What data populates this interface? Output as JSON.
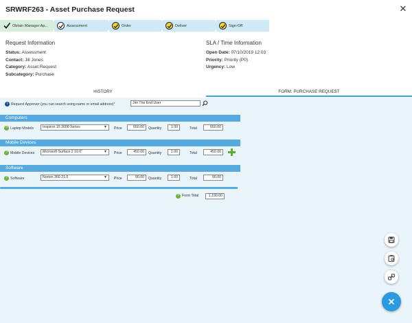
{
  "window": {
    "title": "SRWRF263 - Asset Purchase Request"
  },
  "stages": [
    {
      "label": "Obtain Manager Ap...",
      "state": "done"
    },
    {
      "label": "Assessment",
      "state": "current"
    },
    {
      "label": "Order",
      "state": "pending"
    },
    {
      "label": "Deliver",
      "state": "pending"
    },
    {
      "label": "Sign-Off",
      "state": "pending"
    }
  ],
  "request_info": {
    "heading": "Request Information",
    "rows": [
      {
        "label": "Status:",
        "value": "Assessment"
      },
      {
        "label": "Contact:",
        "value": "Jill Jones"
      },
      {
        "label": "Category:",
        "value": "Asset Request"
      },
      {
        "label": "Subcategory:",
        "value": "Purchase"
      }
    ]
  },
  "sla_info": {
    "heading": "SLA / Time Information",
    "rows": [
      {
        "label": "Open Date:",
        "value": "07/10/2019 12:03"
      },
      {
        "label": "Priority:",
        "value": "Priority (P0)"
      },
      {
        "label": "Urgency:",
        "value": "Low"
      }
    ]
  },
  "tabs": [
    {
      "label": "HISTORY",
      "active": false
    },
    {
      "label": "FORM: PURCHASE REQUEST",
      "active": true
    }
  ],
  "form": {
    "approver_label": "Request Approver (you can search using name or email address)",
    "approver_required": "*",
    "approver_value": "Jim The End User",
    "price_label": "Price",
    "quantity_label": "Quantity",
    "total_label": "Total",
    "sections": [
      {
        "title": "Computers",
        "item_label": "Laptop Models",
        "selected": "Inspiron 15 3000 Series",
        "price": "650.00",
        "quantity": "1.00",
        "total": "650.00"
      },
      {
        "title": "Mobile Devices",
        "item_label": "Mobile Devices",
        "selected": "Microsoft Surface 2 10.6\"",
        "price": "450.00",
        "quantity": "1.00",
        "total": "450.00"
      },
      {
        "title": "Software",
        "item_label": "Software",
        "selected": "Norton 360 21.0",
        "price": "90.00",
        "quantity": "1.00",
        "total": "90.00"
      }
    ],
    "form_total_label": "Form Total",
    "form_total_value": "1,190.00"
  },
  "colors": {
    "accent": "#2a9be0",
    "section": "#56aadf",
    "stage": "#cfe9f6",
    "help": "#6fb23a"
  },
  "icons": {
    "close": "close-icon",
    "save": "save-icon",
    "clipboard": "clipboard-icon",
    "link": "link-icon",
    "fab": "close-icon"
  }
}
